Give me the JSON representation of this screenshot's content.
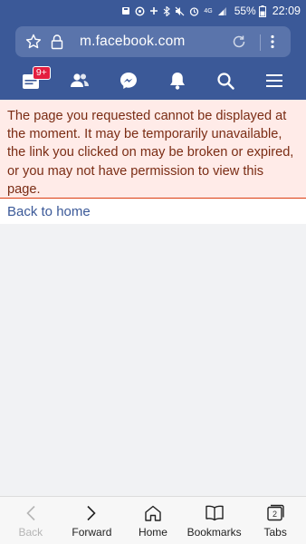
{
  "status_bar": {
    "battery_percent": "55%",
    "time": "22:09",
    "network": "4G"
  },
  "browser": {
    "url": "m.facebook.com"
  },
  "fb_nav": {
    "notifications_badge": "9+"
  },
  "error": {
    "message": "The page you requested cannot be displayed at the moment. It may be temporarily unavailable, the link you clicked on may be broken or expired, or you may not have permission to view this page."
  },
  "back_link": "Back to home",
  "bottom_bar": {
    "back": "Back",
    "forward": "Forward",
    "home": "Home",
    "bookmarks": "Bookmarks",
    "tabs": "Tabs",
    "tabs_count": "2"
  }
}
